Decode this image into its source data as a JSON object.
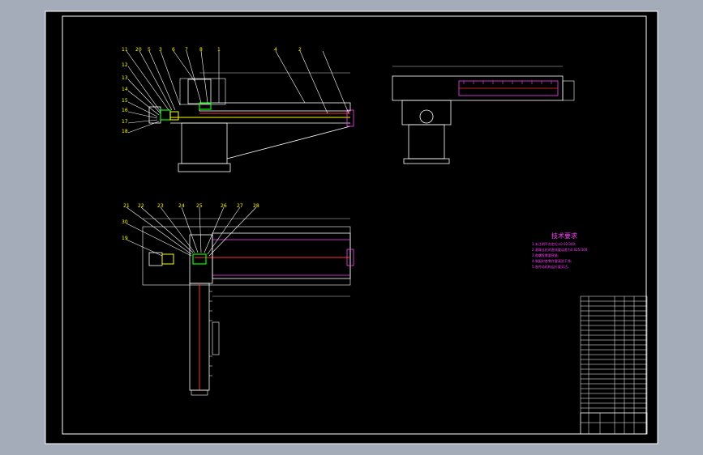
{
  "drawing": {
    "colors": {
      "background": "#a5acb9",
      "paper": "#000000",
      "frame": "#ffffff",
      "yellow": "#ffff00",
      "green": "#00ff00",
      "red": "#ff3030",
      "magenta": "#ff40ff",
      "cyan": "#40e0ff",
      "grey": "#c8c8c8"
    },
    "tech_requirements": {
      "title": "技术要求",
      "items": [
        "1.未注明平台定位±0.02/300;",
        "2.滚珠丝杠的直线度误差为0.025/300;",
        "3.各螺栓需要预紧;",
        "4.装配时各零件要清洗干净;",
        "5.各传动机构运行要灵活。"
      ]
    },
    "balloons_front_view": [
      "11",
      "20",
      "5",
      "3",
      "6",
      "7",
      "8",
      "1",
      "4",
      "2"
    ],
    "balloons_front_view_left": [
      "12",
      "13",
      "14",
      "15",
      "16",
      "17",
      "18"
    ],
    "balloons_plan_view": [
      "21",
      "22",
      "23",
      "24",
      "25",
      "26",
      "27",
      "28"
    ],
    "balloons_plan_view_left": [
      "30",
      "19"
    ]
  }
}
